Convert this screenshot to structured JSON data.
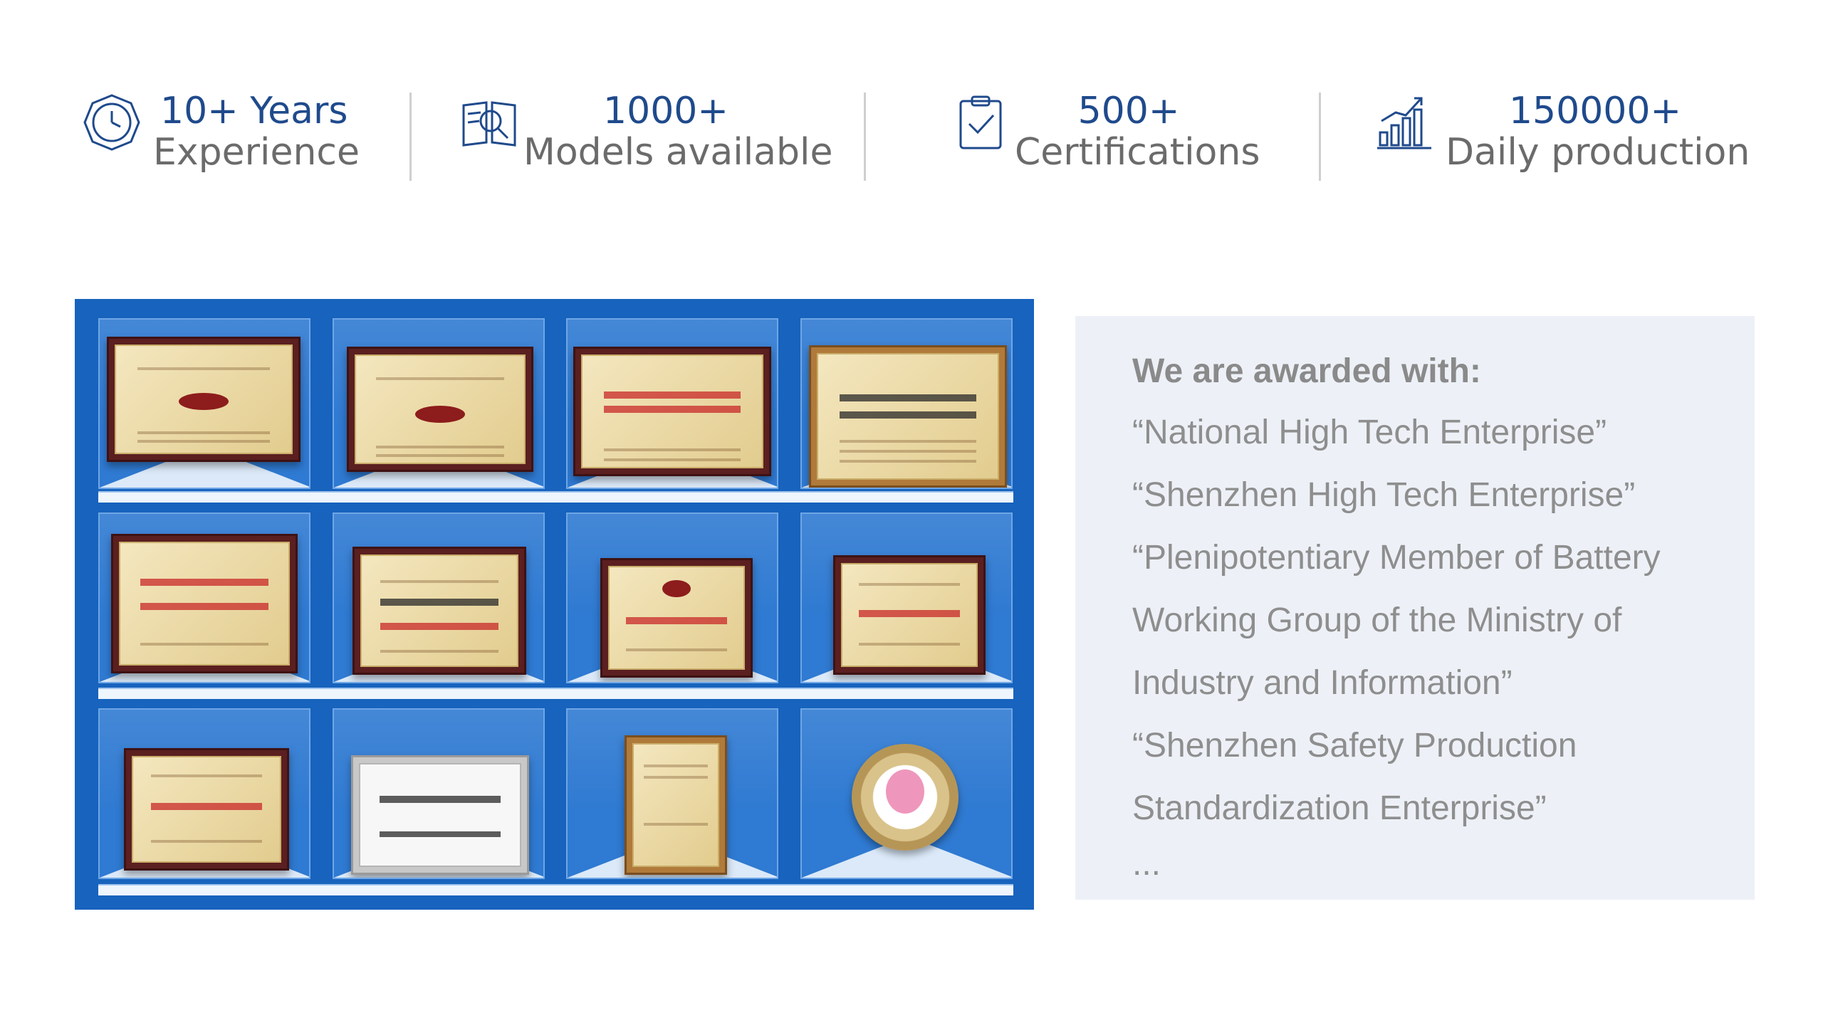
{
  "stats": [
    {
      "icon": "clock-icon",
      "number": "10+ Years",
      "label": "Experience"
    },
    {
      "icon": "book-search-icon",
      "number": "1000+",
      "label": "Models available"
    },
    {
      "icon": "clipboard-check-icon",
      "number": "500+",
      "label": "Certifications"
    },
    {
      "icon": "bar-chart-growth-icon",
      "number": "150000+",
      "label": "Daily production"
    }
  ],
  "awards": {
    "title": "We are awarded with:",
    "lines": [
      "“National High Tech Enterprise”",
      "“Shenzhen High Tech Enterprise”",
      "“Plenipotentiary Member of Battery",
      "Working Group of the Ministry of",
      "Industry and Information”",
      "“Shenzhen Safety Production",
      "Standardization Enterprise”"
    ],
    "more": "..."
  },
  "colors": {
    "accent_blue": "#1f4a8c",
    "panel_blue": "#1763bd",
    "awards_bg": "#edf1f7",
    "label_gray": "#6b6b6b"
  }
}
